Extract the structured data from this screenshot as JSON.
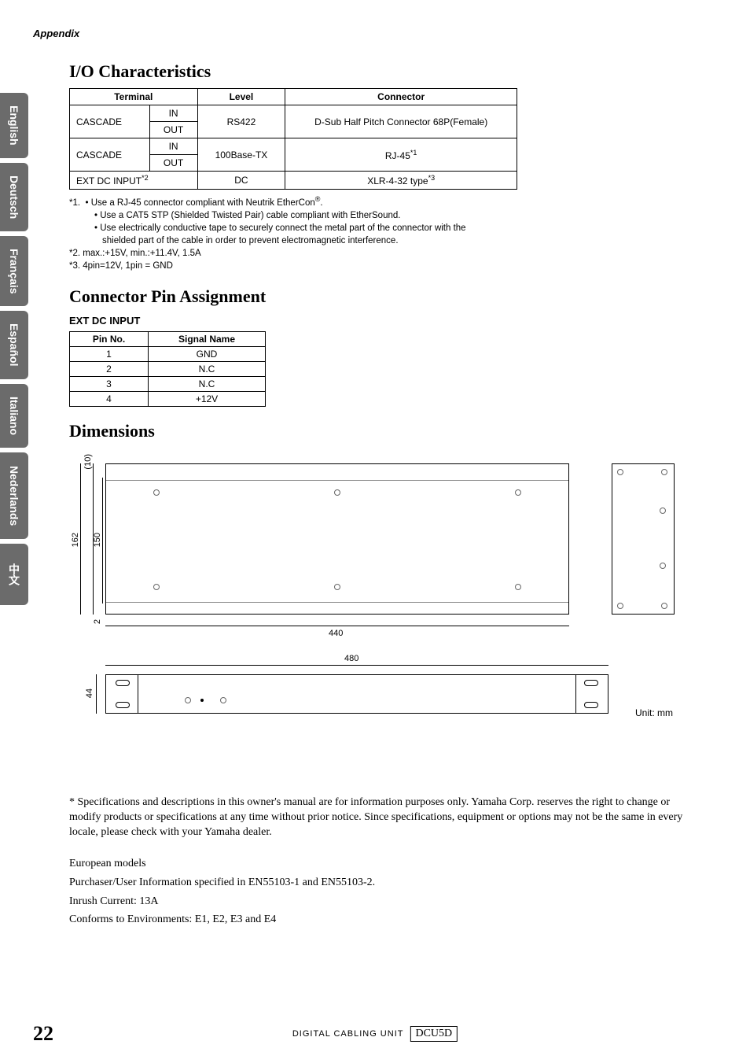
{
  "header": {
    "appendix": "Appendix"
  },
  "tabs": {
    "english": "English",
    "deutsch": "Deutsch",
    "francais": "Français",
    "espanol": "Español",
    "italiano": "Italiano",
    "nederlands": "Nederlands",
    "chinese": "中文"
  },
  "sections": {
    "io_title": "I/O Characteristics",
    "connector_title": "Connector Pin Assignment",
    "dimensions_title": "Dimensions"
  },
  "io_table": {
    "headers": {
      "terminal": "Terminal",
      "level": "Level",
      "connector": "Connector"
    },
    "rows": [
      {
        "terminal": "CASCADE",
        "sub1": "IN",
        "sub2": "OUT",
        "level": "RS422",
        "connector": "D-Sub Half Pitch Connector 68P(Female)"
      },
      {
        "terminal": "CASCADE",
        "sub1": "IN",
        "sub2": "OUT",
        "level": "100Base-TX",
        "connector": "RJ-45",
        "conn_sup": "*1"
      },
      {
        "terminal": "EXT DC INPUT",
        "term_sup": "*2",
        "level": "DC",
        "connector": "XLR-4-32 type",
        "conn_sup": "*3"
      }
    ]
  },
  "notes": {
    "n1_lead": "*1.",
    "n1_a": "• Use a RJ-45 connector compliant with Neutrik EtherCon",
    "n1_a_sup": "®",
    "n1_a_end": ".",
    "n1_b": "• Use a CAT5 STP (Shielded Twisted Pair) cable compliant with EtherSound.",
    "n1_c": "• Use electrically conductive tape to securely connect the metal part of the connector with the",
    "n1_c2": "shielded part of the cable in order to prevent electromagnetic interference.",
    "n2": "*2. max.:+15V, min.:+11.4V, 1.5A",
    "n3": "*3. 4pin=12V, 1pin = GND"
  },
  "pin": {
    "sub_heading": "EXT DC INPUT",
    "headers": {
      "pin": "Pin No.",
      "signal": "Signal Name"
    },
    "rows": [
      {
        "pin": "1",
        "signal": "GND"
      },
      {
        "pin": "2",
        "signal": "N.C"
      },
      {
        "pin": "3",
        "signal": "N.C"
      },
      {
        "pin": "4",
        "signal": "+12V"
      }
    ]
  },
  "dims": {
    "d10": "(10)",
    "d162": "162",
    "d150": "150",
    "d2": "2",
    "d440": "440",
    "d480": "480",
    "d44": "44",
    "unit": "Unit: mm"
  },
  "disclaimer": "* Specifications and descriptions in this owner's manual are for information purposes only. Yamaha Corp. reserves the right to change or modify products or specifications at any time without prior notice. Since specifications, equipment or options may not be the same in every locale, please check with your Yamaha dealer.",
  "euro": {
    "title": "European models",
    "l1": "Purchaser/User Information specified in EN55103-1 and EN55103-2.",
    "l2": "Inrush Current: 13A",
    "l3": "Conforms to Environments: E1, E2, E3 and E4"
  },
  "footer": {
    "page": "22",
    "center_text": "DIGITAL CABLING UNIT",
    "product": "DCU5D"
  }
}
